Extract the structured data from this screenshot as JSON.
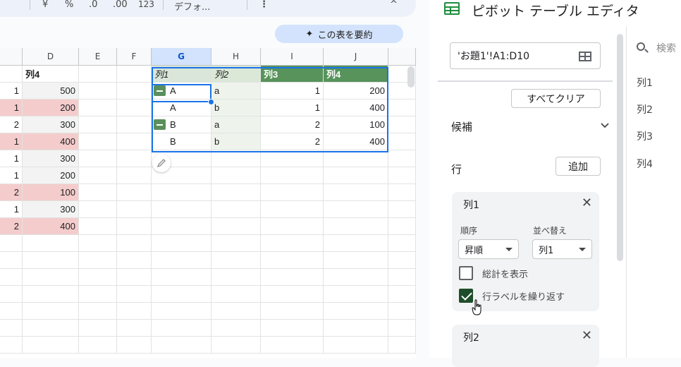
{
  "toolbar": {
    "yen_label": "¥",
    "percent_label": "%",
    "decrease_decimal_label": ".0",
    "increase_decimal_label": ".00",
    "format_123_label": "123",
    "font_label": "デフォ...",
    "more_label": "⋮",
    "collapse_label": "^"
  },
  "summarize_button": {
    "label": "この表を要約",
    "icon": "sparkle-icon"
  },
  "sheet": {
    "column_headers": [
      "D",
      "E",
      "F",
      "G",
      "H",
      "I",
      "J"
    ],
    "selected_column": "G",
    "source_header": "列4",
    "source_rows": [
      {
        "a": "1",
        "d": "500",
        "pink": false
      },
      {
        "a": "1",
        "d": "200",
        "pink": true
      },
      {
        "a": "2",
        "d": "300",
        "pink": false
      },
      {
        "a": "1",
        "d": "400",
        "pink": true
      },
      {
        "a": "1",
        "d": "300",
        "pink": false
      },
      {
        "a": "1",
        "d": "200",
        "pink": false
      },
      {
        "a": "2",
        "d": "100",
        "pink": true
      },
      {
        "a": "1",
        "d": "300",
        "pink": false
      },
      {
        "a": "2",
        "d": "400",
        "pink": true
      }
    ],
    "pivot": {
      "headers": [
        "列1",
        "列2",
        "列3",
        "列4"
      ],
      "rows": [
        {
          "c1": "A",
          "c2": "a",
          "c3": "1",
          "c4": "200",
          "collapse": true
        },
        {
          "c1": "A",
          "c2": "b",
          "c3": "1",
          "c4": "400",
          "collapse": false
        },
        {
          "c1": "B",
          "c2": "a",
          "c3": "2",
          "c4": "100",
          "collapse": true
        },
        {
          "c1": "B",
          "c2": "b",
          "c3": "2",
          "c4": "400",
          "collapse": false
        }
      ]
    }
  },
  "editor": {
    "title": "ピボット テーブル エディタ",
    "range": "'お題1'!A1:D10",
    "clear_all": "すべてクリア",
    "suggestions": "候補",
    "rows_label": "行",
    "add_label": "追加",
    "card1": {
      "name": "列1",
      "order_label": "順序",
      "sort_label": "並べ替え",
      "order_value": "昇順",
      "sort_value": "列1",
      "show_totals": "総計を表示",
      "show_totals_checked": false,
      "repeat_labels": "行ラベルを繰り返す",
      "repeat_labels_checked": true
    },
    "card2": {
      "name": "列2"
    },
    "search_placeholder": "検索",
    "fields": [
      "列1",
      "列2",
      "列3",
      "列4"
    ]
  }
}
